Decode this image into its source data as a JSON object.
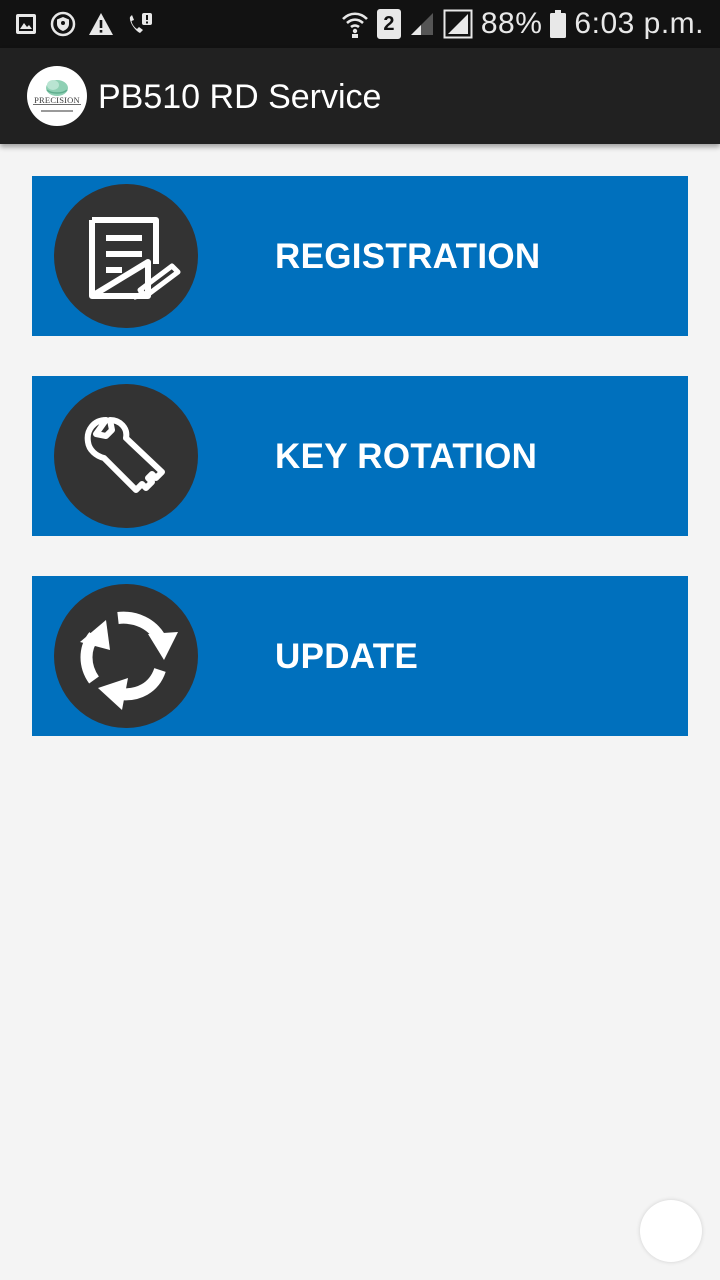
{
  "status_bar": {
    "icons": [
      "gallery-icon",
      "shield-icon",
      "warning-icon",
      "wifi-call-icon",
      "wifi-icon",
      "signal-weak-icon",
      "signal-icon",
      "battery-icon"
    ],
    "sim_slot": "2",
    "battery_percent": "88%",
    "time": "6:03 p.m."
  },
  "app_bar": {
    "logo_text": "PRECISION",
    "title": "PB510 RD Service"
  },
  "menu": {
    "items": [
      {
        "label": "REGISTRATION",
        "icon": "document-edit-icon"
      },
      {
        "label": "KEY ROTATION",
        "icon": "key-wrench-icon"
      },
      {
        "label": "UPDATE",
        "icon": "refresh-arrows-icon"
      }
    ]
  },
  "colors": {
    "status_bar": "#121212",
    "app_bar": "#212121",
    "card_blue": "#0070bd",
    "icon_circle": "#333333",
    "background": "#f4f4f4"
  }
}
